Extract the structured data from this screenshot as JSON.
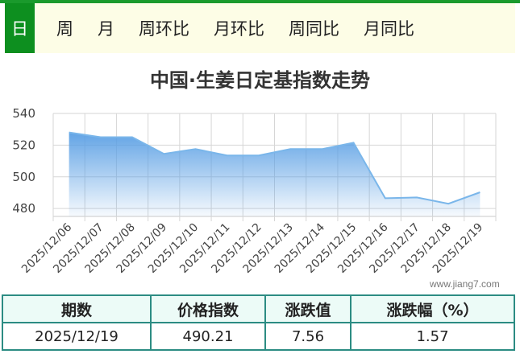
{
  "tabs": [
    {
      "label": "日",
      "active": true
    },
    {
      "label": "周",
      "active": false
    },
    {
      "label": "月",
      "active": false
    },
    {
      "label": "周环比",
      "active": false
    },
    {
      "label": "月环比",
      "active": false
    },
    {
      "label": "周同比",
      "active": false
    },
    {
      "label": "月同比",
      "active": false
    }
  ],
  "chart_data": {
    "type": "area",
    "title": "中国·生姜日定基指数走势",
    "xlabel": "",
    "ylabel": "",
    "x": [
      "2025/12/06",
      "2025/12/07",
      "2025/12/08",
      "2025/12/09",
      "2025/12/10",
      "2025/12/11",
      "2025/12/12",
      "2025/12/13",
      "2025/12/14",
      "2025/12/15",
      "2025/12/16",
      "2025/12/17",
      "2025/12/18",
      "2025/12/19"
    ],
    "values": [
      528,
      525,
      525,
      514.5,
      517.5,
      513.5,
      513.5,
      517.5,
      517.5,
      521.5,
      486.5,
      487,
      483,
      490.21
    ],
    "ylim": [
      475,
      540
    ],
    "yticks": [
      480,
      500,
      520,
      540
    ],
    "grid": true,
    "colors": {
      "line": "#7ab6ea",
      "fill_top": "#5a9fe4",
      "grid": "#d6d6d6"
    }
  },
  "watermark": "www.jiang7.com",
  "table": {
    "headers": [
      "期数",
      "价格指数",
      "涨跌值",
      "涨跌幅（%）"
    ],
    "row": [
      "2025/12/19",
      "490.21",
      "7.56",
      "1.57"
    ]
  }
}
